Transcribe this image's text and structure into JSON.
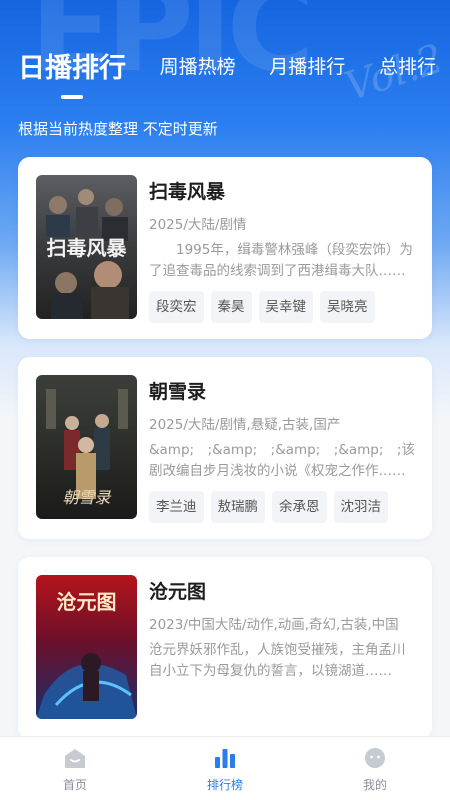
{
  "header": {
    "tabs": [
      {
        "label": "日播排行",
        "active": true
      },
      {
        "label": "周播热榜",
        "active": false
      },
      {
        "label": "月播排行",
        "active": false
      },
      {
        "label": "总排行",
        "active": false
      }
    ],
    "subtitle": "根据当前热度整理 不定时更新"
  },
  "items": [
    {
      "title": "扫毒风暴",
      "meta": "2025/大陆/剧情",
      "desc": "　　1995年，缉毒警林强峰（段奕宏饰）为了追查毒品的线索调到了西港缉毒大队……",
      "actors": [
        "段奕宏",
        "秦昊",
        "吴幸键",
        "吴晓亮"
      ],
      "poster_text": "扫毒风暴"
    },
    {
      "title": "朝雪录",
      "meta": "2025/大陆/剧情,悬疑,古装,国产",
      "desc": "&amp;　;&amp;　;&amp;　;&amp;　;该剧改编自步月浅妆的小说《权宠之作作……",
      "actors": [
        "李兰迪",
        "敖瑞鹏",
        "余承恩",
        "沈羽洁"
      ],
      "poster_text": "朝雪录"
    },
    {
      "title": "沧元图",
      "meta": "2023/中国大陆/动作,动画,奇幻,古装,中国",
      "desc": "沧元界妖邪作乱，人族饱受摧残，主角孟川自小立下为母复仇的誓言，以镜湖道……",
      "actors": [],
      "poster_text": "沧元图"
    }
  ],
  "bottom_nav": [
    {
      "label": "首页",
      "icon": "home-icon",
      "active": false
    },
    {
      "label": "排行榜",
      "icon": "ranking-icon",
      "active": true
    },
    {
      "label": "我的",
      "icon": "profile-icon",
      "active": false
    }
  ],
  "colors": {
    "accent": "#2b7cf0",
    "header_blue": "#1565e0"
  }
}
